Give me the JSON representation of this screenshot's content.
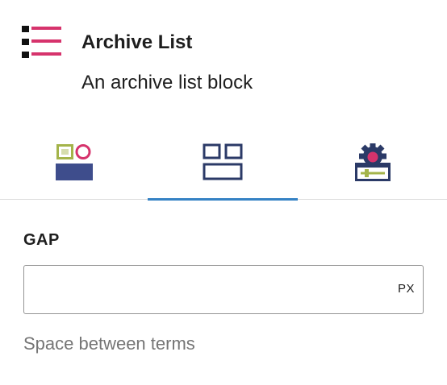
{
  "block": {
    "icon": "list-icon",
    "title": "Archive List",
    "description": "An archive list block"
  },
  "tabs": [
    {
      "icon": "styles-icon",
      "active": false
    },
    {
      "icon": "layout-grid-icon",
      "active": true
    },
    {
      "icon": "advanced-settings-icon",
      "active": false
    }
  ],
  "gap": {
    "label": "GAP",
    "value": "",
    "placeholder": "",
    "unit": "PX",
    "help": "Space between terms"
  },
  "colors": {
    "accent_pink": "#d6336c",
    "navy": "#2b3a67",
    "olive": "#a4b44a",
    "blue_fill": "#3e4d8c",
    "tab_indicator": "#3582c4"
  }
}
